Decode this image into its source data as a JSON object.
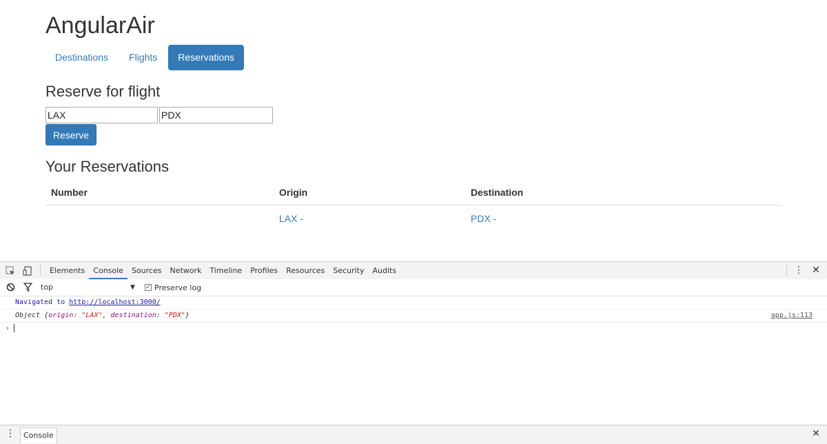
{
  "app": {
    "title": "AngularAir",
    "nav": [
      {
        "label": "Destinations",
        "active": false
      },
      {
        "label": "Flights",
        "active": false
      },
      {
        "label": "Reservations",
        "active": true
      }
    ],
    "reserve_heading": "Reserve for flight",
    "origin_value": "LAX",
    "destination_value": "PDX",
    "reserve_button": "Reserve",
    "reservations_heading": "Your Reservations",
    "table": {
      "headers": [
        "Number",
        "Origin",
        "Destination"
      ],
      "rows": [
        {
          "number": "",
          "origin": "LAX -",
          "destination": "PDX -"
        }
      ]
    },
    "colors": {
      "accent": "#337ab7"
    }
  },
  "devtools": {
    "tabs": [
      "Elements",
      "Console",
      "Sources",
      "Network",
      "Timeline",
      "Profiles",
      "Resources",
      "Security",
      "Audits"
    ],
    "active_tab": "Console",
    "context": "top",
    "preserve_log_label": "Preserve log",
    "preserve_log_checked": true,
    "console": {
      "nav_prefix": "Navigated to ",
      "nav_url": "http://localhost:3000/",
      "object_prefix": "Object ",
      "object_open": "{",
      "obj_key1": "origin",
      "obj_val1": "\"LAX\"",
      "obj_sep": ", ",
      "obj_key2": "destination",
      "obj_val2": "\"PDX\"",
      "object_close": "}",
      "source": "app.js:113"
    },
    "drawer_tab": "Console",
    "icons": [
      "inspect-icon",
      "device-mode-icon",
      "clear-console-icon",
      "filter-icon",
      "kebab-menu-icon",
      "close-icon"
    ]
  }
}
